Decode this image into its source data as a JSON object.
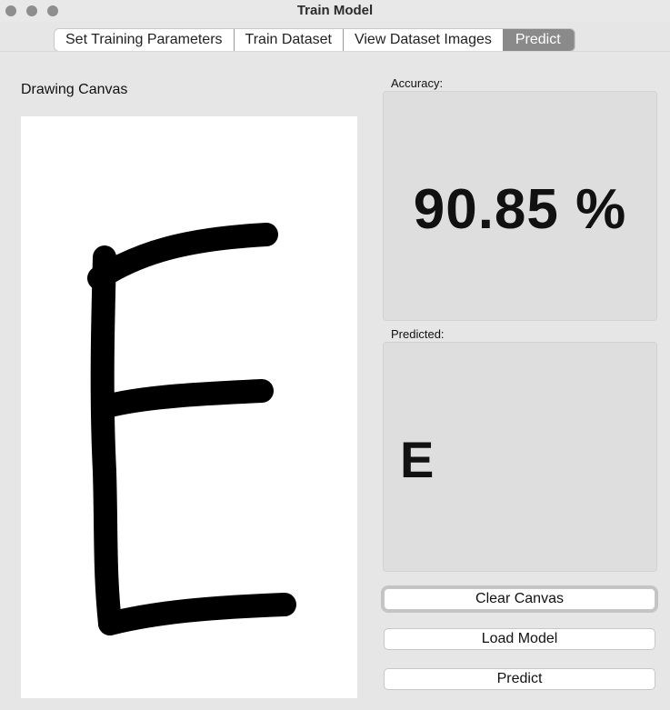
{
  "window": {
    "title": "Train Model"
  },
  "tabs": [
    {
      "label": "Set Training Parameters"
    },
    {
      "label": "Train Dataset"
    },
    {
      "label": "View Dataset Images"
    },
    {
      "label": "Predict"
    }
  ],
  "canvas": {
    "label": "Drawing Canvas"
  },
  "accuracy": {
    "label": "Accuracy:",
    "value": "90.85 %"
  },
  "predicted": {
    "label": "Predicted:",
    "value": "E"
  },
  "buttons": {
    "clear": "Clear Canvas",
    "load": "Load Model",
    "predict": "Predict"
  }
}
